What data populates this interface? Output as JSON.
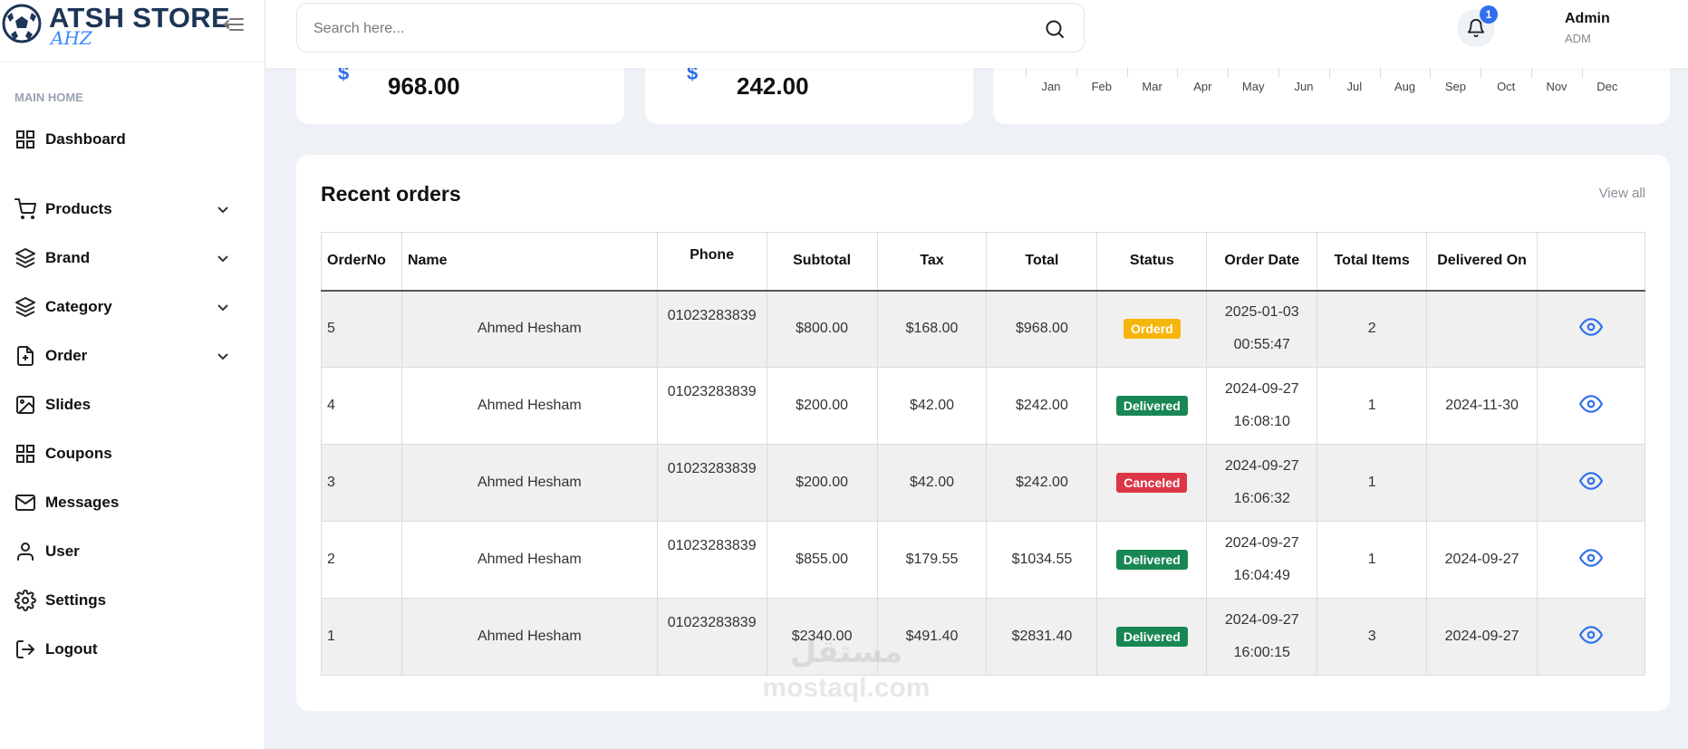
{
  "brand": {
    "name": "ATSH STORE",
    "sub": "AHZ"
  },
  "sidebar": {
    "section_label": "MAIN HOME",
    "items": [
      {
        "label": "Dashboard"
      },
      {
        "label": "Products"
      },
      {
        "label": "Brand"
      },
      {
        "label": "Category"
      },
      {
        "label": "Order"
      },
      {
        "label": "Slides"
      },
      {
        "label": "Coupons"
      },
      {
        "label": "Messages"
      },
      {
        "label": "User"
      },
      {
        "label": "Settings"
      },
      {
        "label": "Logout"
      }
    ]
  },
  "search": {
    "placeholder": "Search here..."
  },
  "notifications": {
    "count": "1"
  },
  "user": {
    "name": "Admin",
    "role": "ADM"
  },
  "stats": [
    {
      "symbol": "$",
      "value": "968.00"
    },
    {
      "symbol": "$",
      "value": "242.00"
    }
  ],
  "chart": {
    "months": [
      "Jan",
      "Feb",
      "Mar",
      "Apr",
      "May",
      "Jun",
      "Jul",
      "Aug",
      "Sep",
      "Oct",
      "Nov",
      "Dec"
    ]
  },
  "orders": {
    "title": "Recent orders",
    "view_all": "View all",
    "columns": [
      "OrderNo",
      "Name",
      "Phone",
      "Subtotal",
      "Tax",
      "Total",
      "Status",
      "Order Date",
      "Total Items",
      "Delivered On",
      ""
    ],
    "rows": [
      {
        "no": "5",
        "name": "Ahmed Hesham",
        "phone": "01023283839",
        "subtotal": "$800.00",
        "tax": "$168.00",
        "total": "$968.00",
        "status": "Orderd",
        "status_color": "#f5b50a",
        "date": "2025-01-03",
        "time": "00:55:47",
        "items": "2",
        "delivered": ""
      },
      {
        "no": "4",
        "name": "Ahmed Hesham",
        "phone": "01023283839",
        "subtotal": "$200.00",
        "tax": "$42.00",
        "total": "$242.00",
        "status": "Delivered",
        "status_color": "#198754",
        "date": "2024-09-27",
        "time": "16:08:10",
        "items": "1",
        "delivered": "2024-11-30"
      },
      {
        "no": "3",
        "name": "Ahmed Hesham",
        "phone": "01023283839",
        "subtotal": "$200.00",
        "tax": "$42.00",
        "total": "$242.00",
        "status": "Canceled",
        "status_color": "#dc3545",
        "date": "2024-09-27",
        "time": "16:06:32",
        "items": "1",
        "delivered": ""
      },
      {
        "no": "2",
        "name": "Ahmed Hesham",
        "phone": "01023283839",
        "subtotal": "$855.00",
        "tax": "$179.55",
        "total": "$1034.55",
        "status": "Delivered",
        "status_color": "#198754",
        "date": "2024-09-27",
        "time": "16:04:49",
        "items": "1",
        "delivered": "2024-09-27"
      },
      {
        "no": "1",
        "name": "Ahmed Hesham",
        "phone": "01023283839",
        "subtotal": "$2340.00",
        "tax": "$491.40",
        "total": "$2831.40",
        "status": "Delivered",
        "status_color": "#198754",
        "date": "2024-09-27",
        "time": "16:00:15",
        "items": "3",
        "delivered": "2024-09-27"
      }
    ]
  },
  "watermark": {
    "line1": "مستقل",
    "line2": "mostaql.com"
  }
}
